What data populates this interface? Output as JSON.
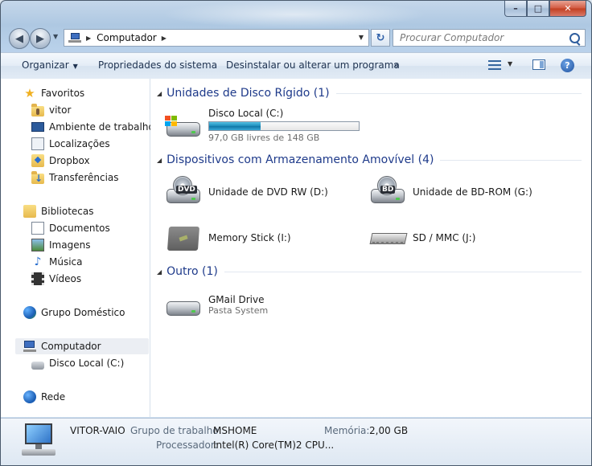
{
  "window": {
    "caption_minimize": "–",
    "caption_maximize": "□",
    "caption_close": "✕"
  },
  "nav": {
    "back_glyph": "◀",
    "forward_glyph": "▶",
    "address_crumb": "Computador",
    "search_placeholder": "Procurar Computador",
    "refresh_glyph": "↻"
  },
  "commandbar": {
    "organize": "Organizar",
    "system_properties": "Propriedades do sistema",
    "uninstall": "Desinstalar ou alterar um programa",
    "more": "»",
    "help": "?"
  },
  "sidebar": {
    "favorites_header": "Favoritos",
    "favorites": [
      "vitor",
      "Ambiente de trabalho",
      "Localizações",
      "Dropbox",
      "Transferências"
    ],
    "libraries_header": "Bibliotecas",
    "libraries": [
      "Documentos",
      "Imagens",
      "Música",
      "Vídeos"
    ],
    "homegroup": "Grupo Doméstico",
    "computer": "Computador",
    "computer_children": [
      "Disco Local (C:)"
    ],
    "network": "Rede"
  },
  "content": {
    "groups": [
      {
        "label": "Unidades de Disco Rígido (1)"
      },
      {
        "label": "Dispositivos com Armazenamento Amovível (4)"
      },
      {
        "label": "Outro (1)"
      }
    ],
    "hdd": {
      "name": "Disco Local (C:)",
      "free_text": "97,0 GB livres de 148 GB",
      "used_fraction": 0.345
    },
    "removable": [
      {
        "name": "Unidade de DVD RW (D:)",
        "badge": "DVD"
      },
      {
        "name": "Unidade de BD-ROM (G:)",
        "badge": "BD"
      },
      {
        "name": "Memory Stick (I:)"
      },
      {
        "name": "SD / MMC (J:)"
      }
    ],
    "other": {
      "name": "GMail Drive",
      "sub": "Pasta System"
    }
  },
  "details": {
    "computer_name": "VITOR-VAIO",
    "workgroup_label": "Grupo de trabalho:",
    "workgroup_value": "MSHOME",
    "memory_label": "Memória:",
    "memory_value": "2,00 GB",
    "processor_label": "Processador:",
    "processor_value": "Intel(R) Core(TM)2 CPU..."
  },
  "colors": {
    "group_header": "#1e3a8a",
    "progress_fill": "#1c8bb9",
    "close_button": "#c23f20"
  }
}
